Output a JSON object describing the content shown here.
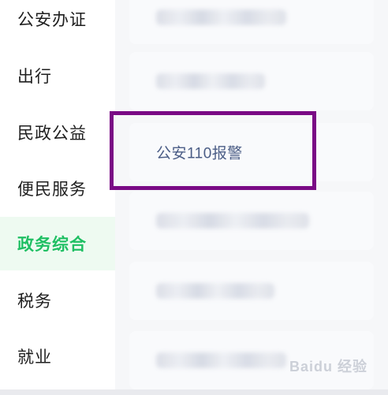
{
  "sidebar": {
    "items": [
      {
        "label": "公安办证"
      },
      {
        "label": "出行"
      },
      {
        "label": "民政公益"
      },
      {
        "label": "便民服务"
      },
      {
        "label": "政务综合",
        "active": true
      },
      {
        "label": "税务"
      },
      {
        "label": "就业"
      }
    ]
  },
  "content": {
    "highlighted_item": {
      "label": "公安110报警"
    }
  },
  "watermark": {
    "text": "Baidu 经验"
  },
  "colors": {
    "active_text": "#1fbf63",
    "active_bg": "#eefaf1",
    "highlight_border": "#7a0a85",
    "service_label": "#4b5d86"
  }
}
